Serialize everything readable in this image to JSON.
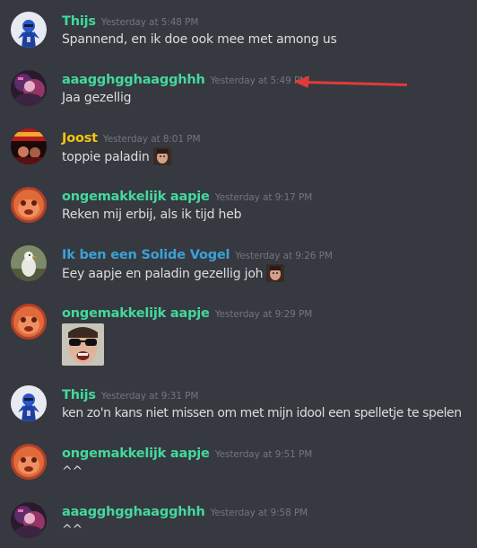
{
  "colors": {
    "background": "#36393f",
    "text": "#dcddde",
    "timestamp": "#72767d",
    "role_green": "#43d99e",
    "role_gold": "#f1c40f",
    "role_blue": "#3ba1d8",
    "annotation_arrow": "#e03a3a"
  },
  "messages": [
    {
      "username": "Thijs",
      "username_color": "#43d99e",
      "timestamp": "Yesterday at 5:48 PM",
      "text": "Spannend, en ik doe ook mee met among us",
      "avatar_icon": "blue-robot-avatar-icon"
    },
    {
      "username": "aaagghgghaagghhh",
      "username_color": "#43d99e",
      "timestamp": "Yesterday at 5:49 PM",
      "text": "Jaa gezellig",
      "avatar_icon": "purple-character-avatar-icon"
    },
    {
      "username": "Joost",
      "username_color": "#f1c40f",
      "timestamp": "Yesterday at 8:01 PM",
      "text": "toppie paladin",
      "avatar_icon": "red-poster-avatar-icon",
      "emoji": "person-face-emoji"
    },
    {
      "username": "ongemakkelijk aapje",
      "username_color": "#43d99e",
      "timestamp": "Yesterday at 9:17 PM",
      "text": "Reken mij erbij, als ik tijd heb",
      "avatar_icon": "orange-face-avatar-icon"
    },
    {
      "username": "Ik ben een Solide Vogel",
      "username_color": "#3ba1d8",
      "timestamp": "Yesterday at 9:26 PM",
      "text": "Eey aapje en paladin gezellig joh",
      "avatar_icon": "bird-avatar-icon",
      "emoji": "person-face-emoji"
    },
    {
      "username": "ongemakkelijk aapje",
      "username_color": "#43d99e",
      "timestamp": "Yesterday at 9:29 PM",
      "text": "",
      "avatar_icon": "orange-face-avatar-icon",
      "attachment": "sunglasses-face-image"
    },
    {
      "username": "Thijs",
      "username_color": "#43d99e",
      "timestamp": "Yesterday at 9:31 PM",
      "text": "ken zo'n kans niet missen om met mijn idool een spelletje te spelen",
      "avatar_icon": "blue-robot-avatar-icon"
    },
    {
      "username": "ongemakkelijk aapje",
      "username_color": "#43d99e",
      "timestamp": "Yesterday at 9:51 PM",
      "text": "^^",
      "avatar_icon": "orange-face-avatar-icon"
    },
    {
      "username": "aaagghgghaagghhh",
      "username_color": "#43d99e",
      "timestamp": "Yesterday at 9:58 PM",
      "text": "^^",
      "avatar_icon": "purple-character-avatar-icon"
    }
  ]
}
